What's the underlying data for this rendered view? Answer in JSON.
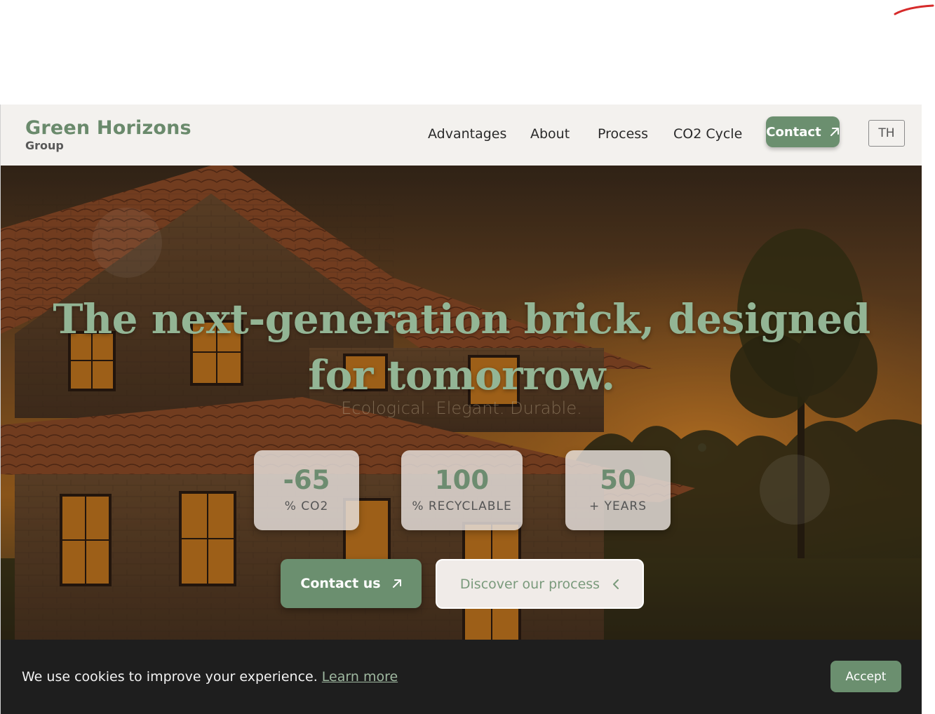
{
  "brand": {
    "name": "Green Horizons",
    "subtitle": "Group"
  },
  "nav": {
    "items": [
      {
        "label": "Advantages"
      },
      {
        "label": "About"
      },
      {
        "label": "Process"
      },
      {
        "label": "CO2 Cycle"
      }
    ],
    "contact_label": "Contact",
    "lang_label": "TH"
  },
  "hero": {
    "title": "The next-generation brick, designed for tomorrow.",
    "subtitle": "Ecological. Elegant. Durable.",
    "stats": [
      {
        "value": "-65",
        "label": "% CO2"
      },
      {
        "value": "100",
        "label": "% RECYCLABLE"
      },
      {
        "value": "50",
        "label": "+ YEARS"
      }
    ],
    "primary_button": "Contact us",
    "secondary_button": "Discover our process"
  },
  "cookie": {
    "text": "We use cookies to improve your experience.",
    "link": "Learn more",
    "accept": "Accept"
  },
  "colors": {
    "brand_green": "#6b8f6f",
    "title_green": "#93b595",
    "header_bg": "#f3f1ee",
    "cookie_bg": "#1e1e1e"
  },
  "icons": {
    "contact": "arrow-up-right-icon",
    "primary": "arrow-up-right-icon",
    "secondary": "chevron-left-icon"
  }
}
